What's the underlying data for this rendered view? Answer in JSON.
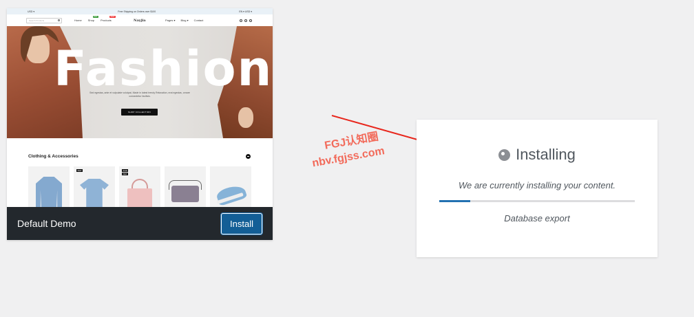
{
  "demo_card": {
    "preview": {
      "topbar": {
        "left": "USD ▾",
        "center": "Free Shipping on Orders over $100",
        "right": "EN ▾  USD ▾"
      },
      "navbar": {
        "search_placeholder": "Search Products",
        "left_items": [
          {
            "label": "Home",
            "badge": ""
          },
          {
            "label": "Shop",
            "badge": "HOT"
          },
          {
            "label": "Products",
            "badge": "NEW"
          }
        ],
        "logo": "Nayjia",
        "right_items": [
          "Pages ▾",
          "Blog ▾",
          "Contact"
        ]
      },
      "hero": {
        "title": "Fashion",
        "subtitle": "Sed egestas, ante et vulputate volutpat, Made in latest trendy Relaxation, erat egestas, ornare consectetur facilisis.",
        "button": "SHOP COLLECTION"
      },
      "category": {
        "title": "Clothing & Accessories",
        "products": [
          {
            "name": "sweater",
            "badges": []
          },
          {
            "name": "t-shirt",
            "badges": [
              "NEW"
            ]
          },
          {
            "name": "handbag",
            "badges": [
              "SALE",
              "NEW"
            ]
          },
          {
            "name": "purse",
            "badges": []
          },
          {
            "name": "sneaker",
            "badges": []
          }
        ]
      }
    },
    "demo_name": "Default Demo",
    "install_label": "Install"
  },
  "watermark": {
    "line1": "FGJ认知圈",
    "line2": "nbv.fgjss.com"
  },
  "install_panel": {
    "title": "Installing",
    "message": "We are currently installing your content.",
    "progress_fraction": 0.16,
    "step": "Database export"
  },
  "colors": {
    "accent": "#2271b1",
    "footer_bg": "#23282d",
    "arrow": "#e8261c",
    "watermark": "#f26b5b"
  }
}
